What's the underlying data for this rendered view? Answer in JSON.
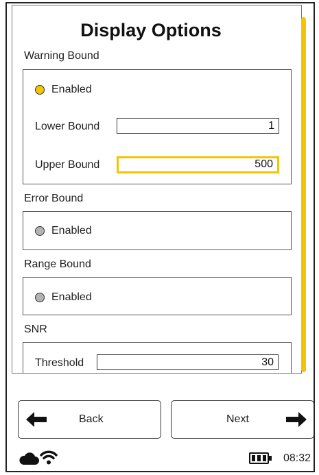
{
  "page": {
    "title": "Display Options"
  },
  "warning_bound": {
    "label": "Warning Bound",
    "enabled_label": "Enabled",
    "enabled": true,
    "lower_label": "Lower Bound",
    "lower_value": "1",
    "upper_label": "Upper Bound",
    "upper_value": "500"
  },
  "error_bound": {
    "label": "Error Bound",
    "enabled_label": "Enabled",
    "enabled": false
  },
  "range_bound": {
    "label": "Range Bound",
    "enabled_label": "Enabled",
    "enabled": false
  },
  "snr": {
    "label": "SNR",
    "threshold_label": "Threshold",
    "threshold_value": "30"
  },
  "nav": {
    "back_label": "Back",
    "next_label": "Next"
  },
  "status_bar": {
    "time": "08:32",
    "icons": [
      "cloud-icon",
      "wifi-icon",
      "battery-icon"
    ],
    "battery_level": 1.0
  },
  "colors": {
    "accent": "#f5c400",
    "disabled_radio": "#b3b3b3"
  }
}
